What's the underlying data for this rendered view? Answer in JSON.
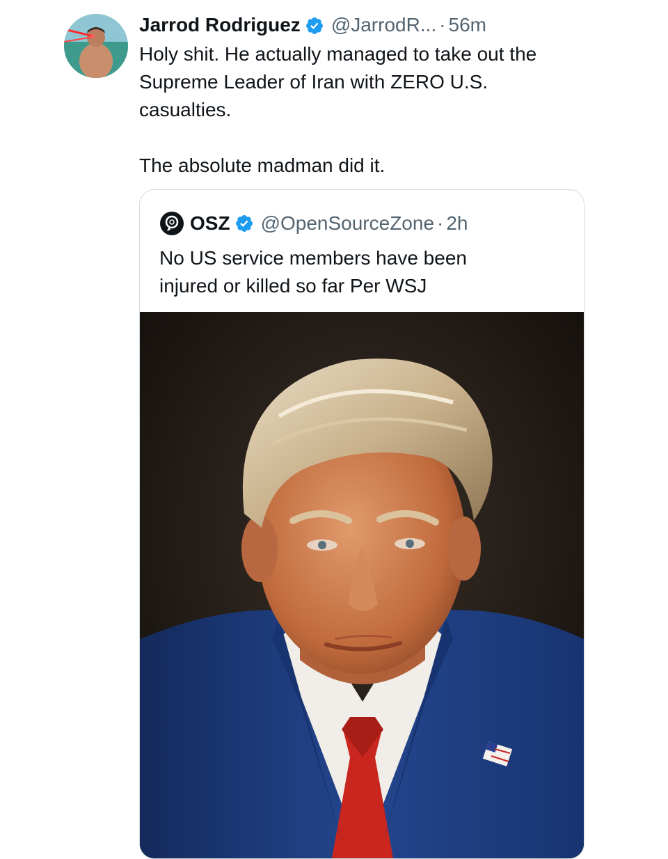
{
  "tweet": {
    "author": {
      "display_name": "Jarrod Rodriguez",
      "handle": "@JarrodR...",
      "verified": true,
      "avatar_icon": "profile-photo"
    },
    "separator": "·",
    "time": "56m",
    "text": "Holy shit. He actually managed to take out the\nSupreme Leader of Iran with ZERO U.S.\ncasualties.\n\nThe absolute madman did it.",
    "quoted": {
      "author": {
        "display_name": "OSZ",
        "handle": "@OpenSourceZone",
        "verified": true,
        "avatar_icon": "osz-logo"
      },
      "separator": "·",
      "time": "2h",
      "text": "No US service members have been\ninjured or killed so far Per WSJ",
      "media": {
        "type": "photo",
        "subject": "portrait photo"
      }
    }
  },
  "colors": {
    "verified_badge": "#1d9bf0",
    "secondary_text": "#536471",
    "border": "#cfd9de",
    "suit": "#213f80",
    "tie": "#c8261e"
  }
}
